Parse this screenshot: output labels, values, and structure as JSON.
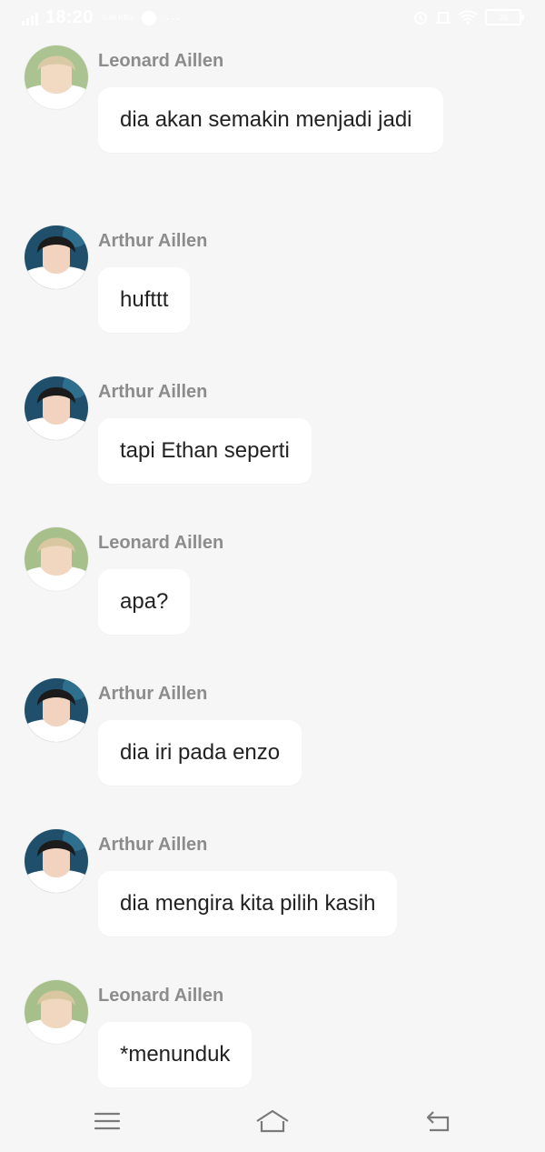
{
  "status_bar": {
    "network": "4G",
    "time": "18:20",
    "speed": "0.46 KB/s",
    "battery": "36"
  },
  "messages": [
    {
      "sender": "Leonard Aillen",
      "text": "dia akan semakin menjadi jadi"
    },
    {
      "sender": "Arthur Aillen",
      "text": "hufttt"
    },
    {
      "sender": "Arthur Aillen",
      "text": "tapi Ethan seperti"
    },
    {
      "sender": "Leonard Aillen",
      "text": "apa?"
    },
    {
      "sender": "Arthur Aillen",
      "text": "dia iri pada enzo"
    },
    {
      "sender": "Arthur Aillen",
      "text": "dia mengira kita pilih kasih"
    },
    {
      "sender": "Leonard Aillen",
      "text": "*menunduk"
    }
  ],
  "nav": {
    "menu_icon": "menu-icon",
    "home_icon": "home-icon",
    "back_icon": "back-icon"
  }
}
